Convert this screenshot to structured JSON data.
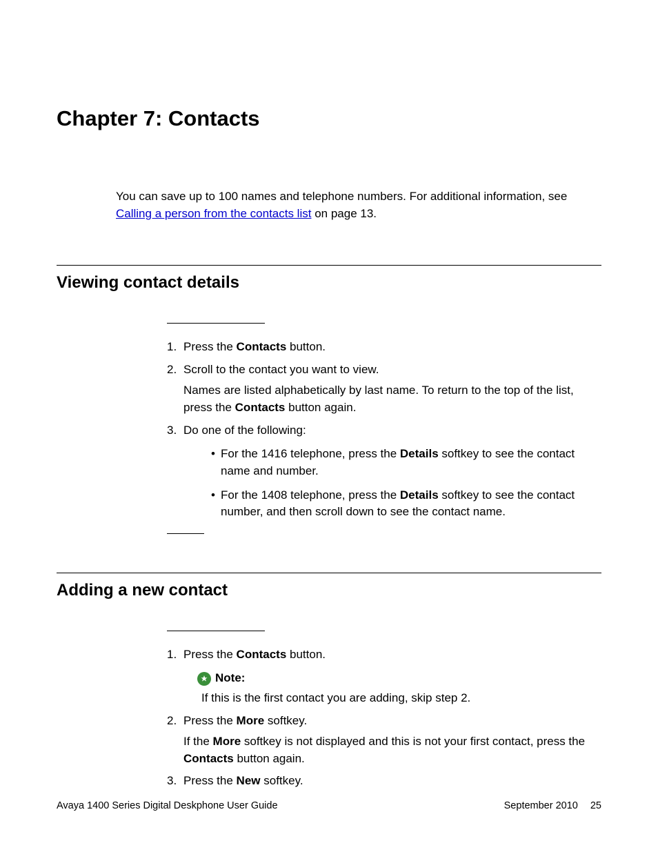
{
  "chapter_title": "Chapter 7:  Contacts",
  "intro": {
    "part1": "You can save up to 100 names and telephone numbers. For additional information, see ",
    "link": "Calling a person from the contacts list",
    "part2": " on page 13."
  },
  "section1": {
    "title": "Viewing contact details",
    "steps": {
      "s1": {
        "num": "1.",
        "pre": "Press the ",
        "bold": "Contacts",
        "post": " button."
      },
      "s2": {
        "num": "2.",
        "line": "Scroll to the contact you want to view.",
        "detail_pre": "Names are listed alphabetically by last name. To return to the top of the list, press the ",
        "detail_bold": "Contacts",
        "detail_post": " button again."
      },
      "s3": {
        "num": "3.",
        "line": "Do one of the following:",
        "b1": {
          "pre": "For the 1416 telephone, press the ",
          "bold": "Details",
          "post": " softkey to see the contact name and number."
        },
        "b2": {
          "pre": "For the 1408 telephone, press the ",
          "bold": "Details",
          "post": " softkey to see the contact number, and then scroll down to see the contact name."
        }
      }
    }
  },
  "section2": {
    "title": "Adding a new contact",
    "steps": {
      "s1": {
        "num": "1.",
        "pre": "Press the ",
        "bold": "Contacts",
        "post": " button.",
        "note_label": "Note:",
        "note_text": "If this is the first contact you are adding, skip step 2."
      },
      "s2": {
        "num": "2.",
        "pre": "Press the ",
        "bold": "More",
        "post": " softkey.",
        "detail_pre": "If the ",
        "detail_bold1": "More",
        "detail_mid": " softkey is not displayed and this is not your first contact, press the ",
        "detail_bold2": "Contacts",
        "detail_post": " button again."
      },
      "s3": {
        "num": "3.",
        "pre": "Press the ",
        "bold": "New",
        "post": " softkey."
      }
    }
  },
  "footer": {
    "left": "Avaya 1400 Series Digital Deskphone User Guide",
    "date": "September 2010",
    "page": "25"
  }
}
